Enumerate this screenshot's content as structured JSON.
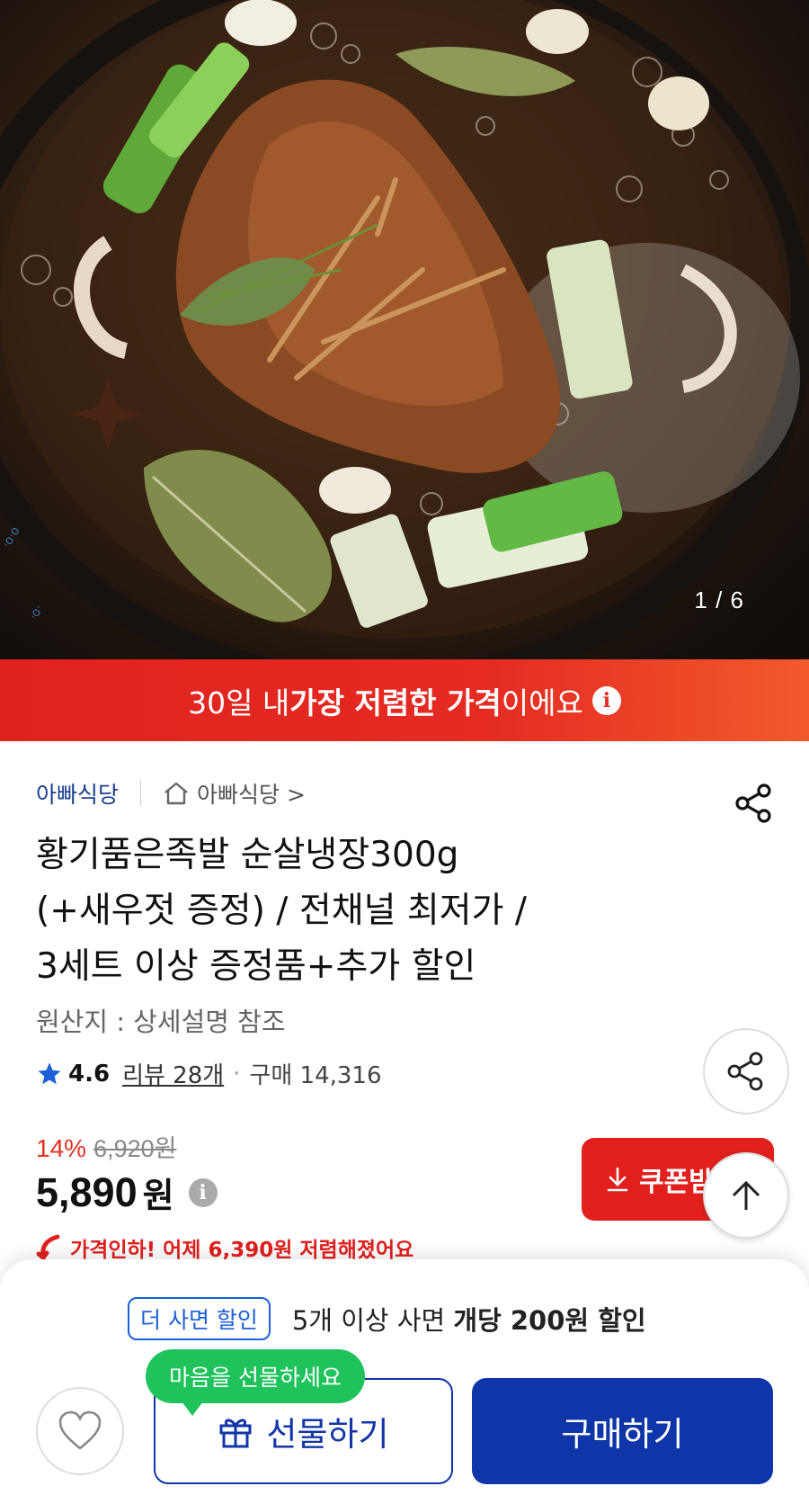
{
  "hero": {
    "counter": "1 / 6",
    "description_icon": "product-photo"
  },
  "banner": {
    "prefix": "30일 내 ",
    "emphasis": "가장 저렴한 가격",
    "suffix": "이에요"
  },
  "store": {
    "name": "아빠식당",
    "home_label": "아빠식당 >"
  },
  "product": {
    "title_line1": "황기품은족발 순살냉장300g",
    "title_line2": "(+새우젓 증정) / 전채널 최저가 /",
    "title_line3": "3세트 이상 증정품+추가 할인",
    "origin": "원산지 : 상세설명 참조"
  },
  "rating": {
    "score": "4.6",
    "reviews": "리뷰 28개",
    "purchases": "구매 14,316"
  },
  "price": {
    "discount": "14%",
    "original": "6,920원",
    "current": "5,890",
    "currency": "원",
    "drop_notice": "가격인하! 어제 6,390원 저렴해졌어요"
  },
  "coupon": {
    "label": "쿠폰받"
  },
  "promo": {
    "tag": "더 사면 할인",
    "text_prefix": "5개 이상 사면 ",
    "text_bold": "개당 200원 할인"
  },
  "actions": {
    "gift_bubble": "마음을 선물하세요",
    "gift_label": "선물하기",
    "buy_label": "구매하기"
  },
  "colors": {
    "accent_red": "#e1201d",
    "primary_blue": "#0f36a8",
    "gift_green": "#1fc25b",
    "star": "#1d5fd6"
  }
}
